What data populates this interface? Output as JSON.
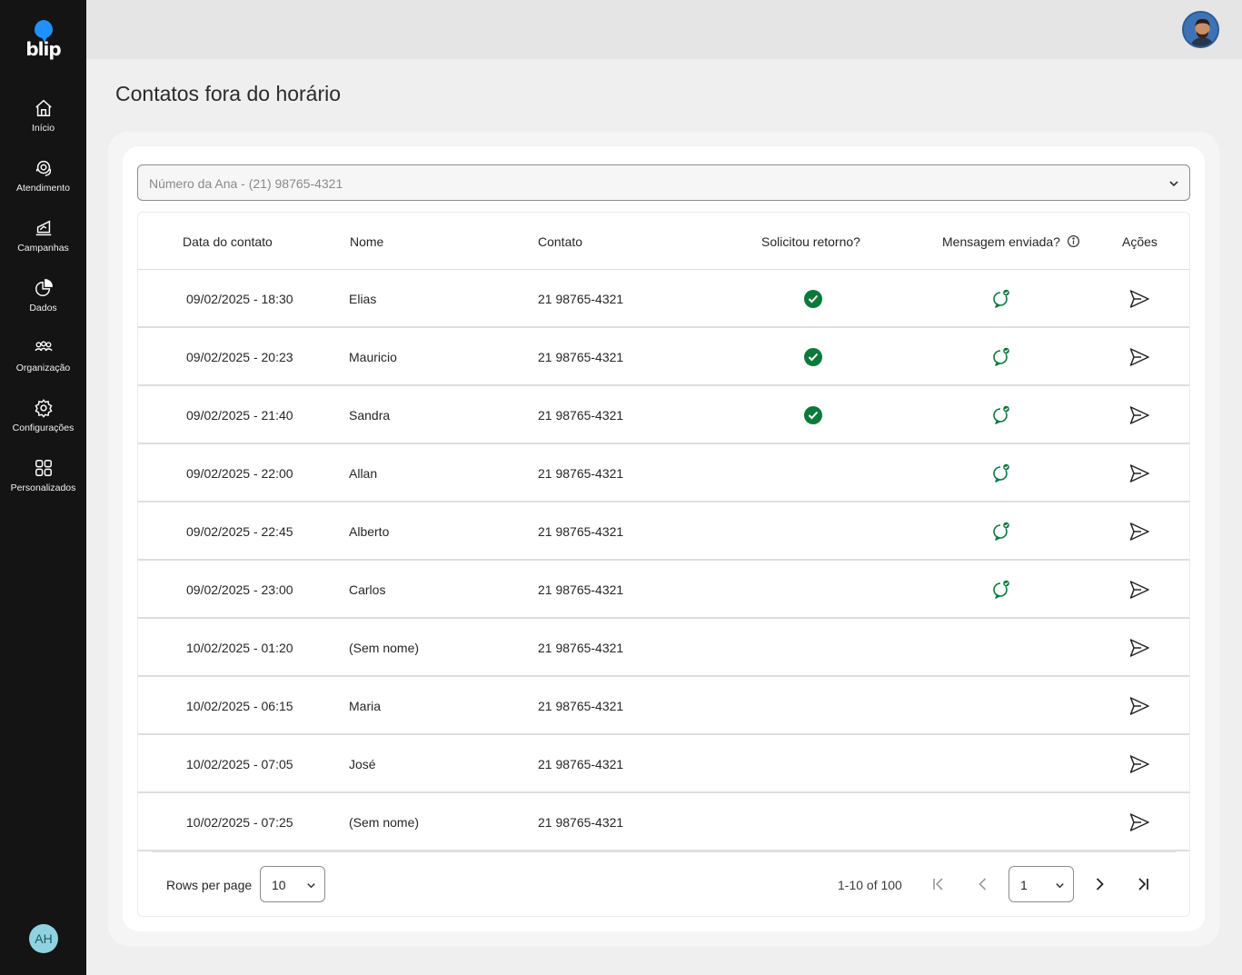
{
  "brand": {
    "logo_text": "blip",
    "accent": "#1e90ff"
  },
  "sidebar": {
    "items": [
      {
        "label": "Início",
        "icon": "home-icon"
      },
      {
        "label": "Atendimento",
        "icon": "headset-icon"
      },
      {
        "label": "Campanhas",
        "icon": "campaign-icon"
      },
      {
        "label": "Dados",
        "icon": "pie-chart-icon"
      },
      {
        "label": "Organização",
        "icon": "users-icon"
      },
      {
        "label": "Configurações",
        "icon": "gear-icon"
      },
      {
        "label": "Personalizados",
        "icon": "grid-icon"
      }
    ],
    "avatar_initials": "AH"
  },
  "page": {
    "title": "Contatos fora do horário"
  },
  "number_select": {
    "value": "Número da Ana - (21) 98765-4321"
  },
  "table": {
    "columns": {
      "date": "Data do contato",
      "name": "Nome",
      "contact": "Contato",
      "requested_return": "Solicitou retorno?",
      "message_sent": "Mensagem enviada?",
      "actions": "Ações"
    },
    "rows": [
      {
        "date": "09/02/2025 - 18:30",
        "name": "Elias",
        "contact": "21 98765-4321",
        "requested_return": true,
        "message_sent": true
      },
      {
        "date": "09/02/2025 - 20:23",
        "name": "Mauricio",
        "contact": "21 98765-4321",
        "requested_return": true,
        "message_sent": true
      },
      {
        "date": "09/02/2025 - 21:40",
        "name": "Sandra",
        "contact": "21 98765-4321",
        "requested_return": true,
        "message_sent": true
      },
      {
        "date": "09/02/2025 - 22:00",
        "name": "Allan",
        "contact": "21 98765-4321",
        "requested_return": false,
        "message_sent": true
      },
      {
        "date": "09/02/2025 - 22:45",
        "name": "Alberto",
        "contact": "21 98765-4321",
        "requested_return": false,
        "message_sent": true
      },
      {
        "date": "09/02/2025 - 23:00",
        "name": "Carlos",
        "contact": "21 98765-4321",
        "requested_return": false,
        "message_sent": true
      },
      {
        "date": "10/02/2025 - 01:20",
        "name": "(Sem nome)",
        "contact": "21 98765-4321",
        "requested_return": false,
        "message_sent": false
      },
      {
        "date": "10/02/2025 - 06:15",
        "name": "Maria",
        "contact": "21 98765-4321",
        "requested_return": false,
        "message_sent": false
      },
      {
        "date": "10/02/2025 - 07:05",
        "name": "José",
        "contact": "21 98765-4321",
        "requested_return": false,
        "message_sent": false
      },
      {
        "date": "10/02/2025 - 07:25",
        "name": "(Sem nome)",
        "contact": "21 98765-4321",
        "requested_return": false,
        "message_sent": false
      }
    ]
  },
  "pagination": {
    "rows_per_page_label": "Rows per page",
    "rows_per_page": "10",
    "range": "1-10 of 100",
    "current_page": "1"
  },
  "colors": {
    "success": "#0a7a3b",
    "sidebar_bg": "#141414"
  }
}
